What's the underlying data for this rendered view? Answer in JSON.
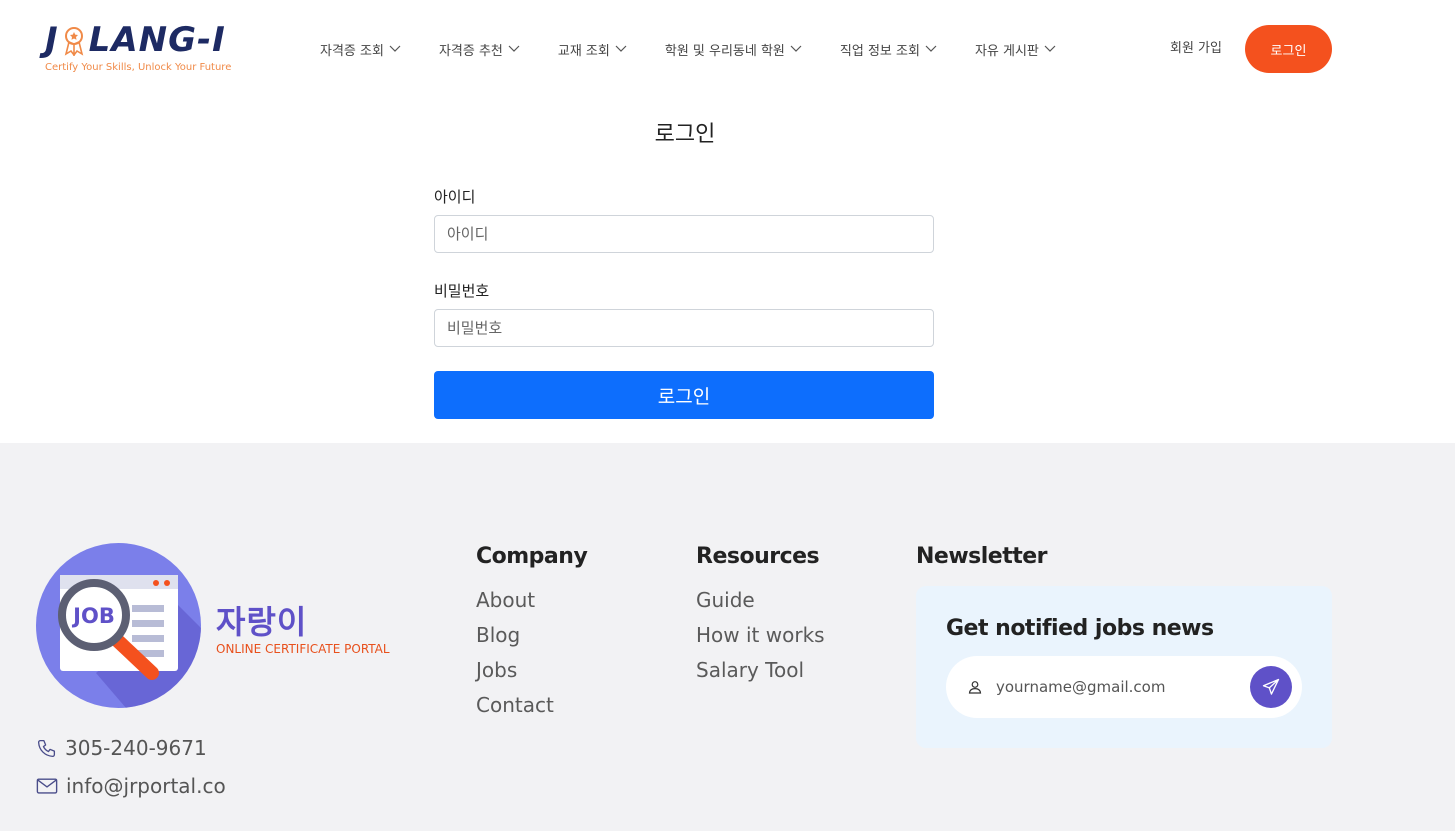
{
  "header": {
    "logo_text_pre": "J",
    "logo_text_post": "LANG-I",
    "logo_tagline": "Certify Your Skills, Unlock Your Future",
    "nav": [
      {
        "label": "자격증 조회"
      },
      {
        "label": "자격증 추천"
      },
      {
        "label": "교재 조회"
      },
      {
        "label": "학원 및 우리동네 학원"
      },
      {
        "label": "직업 정보 조회"
      },
      {
        "label": "자유 게시판"
      }
    ],
    "signup_label": "회원 가입",
    "login_label": "로그인"
  },
  "login_form": {
    "title": "로그인",
    "id_label": "아이디",
    "id_placeholder": "아이디",
    "password_label": "비밀번호",
    "password_placeholder": "비밀번호",
    "submit_label": "로그인"
  },
  "footer": {
    "brand_name": "자랑이",
    "brand_subtitle": "ONLINE CERTIFICATE PORTAL",
    "brand_logo_text": "JOB",
    "phone": "305-240-9671",
    "email": "info@jrportal.co",
    "company": {
      "title": "Company",
      "links": [
        "About",
        "Blog",
        "Jobs",
        "Contact"
      ]
    },
    "resources": {
      "title": "Resources",
      "links": [
        "Guide",
        "How it works",
        "Salary Tool"
      ]
    },
    "newsletter": {
      "title": "Newsletter",
      "heading": "Get notified jobs news",
      "placeholder": "yourname@gmail.com"
    }
  },
  "colors": {
    "accent_orange": "#f4511e",
    "primary_blue": "#0d6efd",
    "brand_purple": "#5f51c8",
    "logo_navy": "#1d2a63"
  }
}
